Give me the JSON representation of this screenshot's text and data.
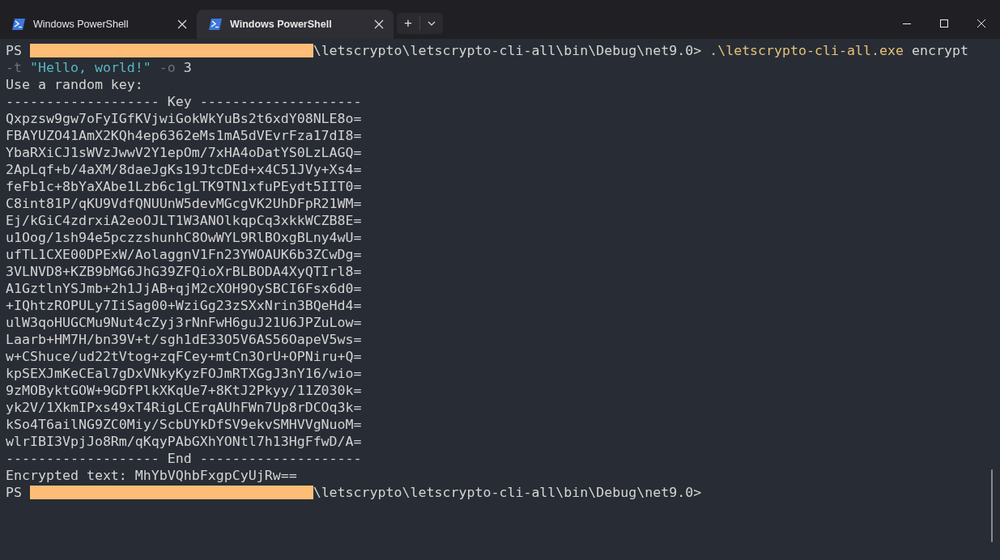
{
  "tabs": [
    {
      "label": "Windows PowerShell",
      "selected": false
    },
    {
      "label": "Windows PowerShell",
      "selected": true
    }
  ],
  "tab_actions": {
    "new_tab": "+"
  },
  "terminal": {
    "lines": [
      {
        "segments": [
          {
            "kind": "plain",
            "text": "PS "
          },
          {
            "kind": "redacted"
          },
          {
            "kind": "plain",
            "text": "\\letscrypto\\letscrypto-cli-all\\bin\\Debug\\net9.0> "
          },
          {
            "kind": "exe",
            "text": ".\\letscrypto-cli-all.exe"
          },
          {
            "kind": "plain",
            "text": " encrypt"
          }
        ]
      },
      {
        "segments": [
          {
            "kind": "flag",
            "text": "-t"
          },
          {
            "kind": "string",
            "text": " \"Hello, world!\""
          },
          {
            "kind": "flag",
            "text": " -o"
          },
          {
            "kind": "plain",
            "text": " 3"
          }
        ]
      },
      {
        "segments": [
          {
            "kind": "plain",
            "text": "Use a random key:"
          }
        ]
      },
      {
        "segments": [
          {
            "kind": "plain",
            "text": "------------------- Key --------------------"
          }
        ]
      },
      {
        "segments": [
          {
            "kind": "plain",
            "text": "Qxpzsw9gw7oFyIGfKVjwiGokWkYuBs2t6xdY08NLE8o="
          }
        ]
      },
      {
        "segments": [
          {
            "kind": "plain",
            "text": "FBAYUZO41AmX2KQh4ep6362eMs1mA5dVEvrFza17dI8="
          }
        ]
      },
      {
        "segments": [
          {
            "kind": "plain",
            "text": "YbaRXiCJ1sWVzJwwV2Y1epOm/7xHA4oDatYS0LzLAGQ="
          }
        ]
      },
      {
        "segments": [
          {
            "kind": "plain",
            "text": "2ApLqf+b/4aXM/8daeJgKs19JtcDEd+x4C51JVy+Xs4="
          }
        ]
      },
      {
        "segments": [
          {
            "kind": "plain",
            "text": "feFb1c+8bYaXAbe1Lzb6c1gLTK9TN1xfuPEydt5IIT0="
          }
        ]
      },
      {
        "segments": [
          {
            "kind": "plain",
            "text": "C8int81P/qKU9VdfQNUUnW5devMGcgVK2UhDFpR21WM="
          }
        ]
      },
      {
        "segments": [
          {
            "kind": "plain",
            "text": "Ej/kGiC4zdrxiA2eoOJLT1W3ANOlkqpCq3xkkWCZB8E="
          }
        ]
      },
      {
        "segments": [
          {
            "kind": "plain",
            "text": "u1Oog/1sh94e5pczzshunhC8OwWYL9RlBOxgBLny4wU="
          }
        ]
      },
      {
        "segments": [
          {
            "kind": "plain",
            "text": "ufTL1CXE00DPExW/AolaggnV1Fn23YWOAUK6b3ZCwDg="
          }
        ]
      },
      {
        "segments": [
          {
            "kind": "plain",
            "text": "3VLNVD8+KZB9bMG6JhG39ZFQioXrBLBODA4XyQTIrl8="
          }
        ]
      },
      {
        "segments": [
          {
            "kind": "plain",
            "text": "A1GztlnYSJmb+2h1JjAB+qjM2cXOH9OySBCI6Fsx6d0="
          }
        ]
      },
      {
        "segments": [
          {
            "kind": "plain",
            "text": "+IQhtzROPULy7IiSag00+WziGg23zSXxNrin3BQeHd4="
          }
        ]
      },
      {
        "segments": [
          {
            "kind": "plain",
            "text": "ulW3qoHUGCMu9Nut4cZyj3rNnFwH6guJ21U6JPZuLow="
          }
        ]
      },
      {
        "segments": [
          {
            "kind": "plain",
            "text": "Laarb+HM7H/bn39V+t/sgh1dE33O5V6AS56OapeV5ws="
          }
        ]
      },
      {
        "segments": [
          {
            "kind": "plain",
            "text": "w+CShuce/ud22tVtog+zqFCey+mtCn3OrU+OPNiru+Q="
          }
        ]
      },
      {
        "segments": [
          {
            "kind": "plain",
            "text": "kpSEXJmKeCEal7gDxVNkyKyzFOJmRTXGgJ3nY16/wio="
          }
        ]
      },
      {
        "segments": [
          {
            "kind": "plain",
            "text": "9zMOByktGOW+9GDfPlkXKqUe7+8KtJ2Pkyy/11Z030k="
          }
        ]
      },
      {
        "segments": [
          {
            "kind": "plain",
            "text": "yk2V/1XkmIPxs49xT4RigLCErqAUhFWn7Up8rDCOq3k="
          }
        ]
      },
      {
        "segments": [
          {
            "kind": "plain",
            "text": "kSo4T6ailNG9ZC0Miy/ScbUYkDfSV9ekvSMHVVgNuoM="
          }
        ]
      },
      {
        "segments": [
          {
            "kind": "plain",
            "text": "wlrIBI3VpjJo8Rm/qKqyPAbGXhYONtl7h13HgFfwD/A="
          }
        ]
      },
      {
        "segments": [
          {
            "kind": "plain",
            "text": "------------------- End --------------------"
          }
        ]
      },
      {
        "segments": [
          {
            "kind": "plain",
            "text": "Encrypted text: MhYbVQhbFxgpCyUjRw=="
          }
        ]
      },
      {
        "segments": [
          {
            "kind": "plain",
            "text": "PS "
          },
          {
            "kind": "redacted"
          },
          {
            "kind": "plain",
            "text": "\\letscrypto\\letscrypto-cli-all\\bin\\Debug\\net9.0>"
          }
        ]
      }
    ]
  }
}
